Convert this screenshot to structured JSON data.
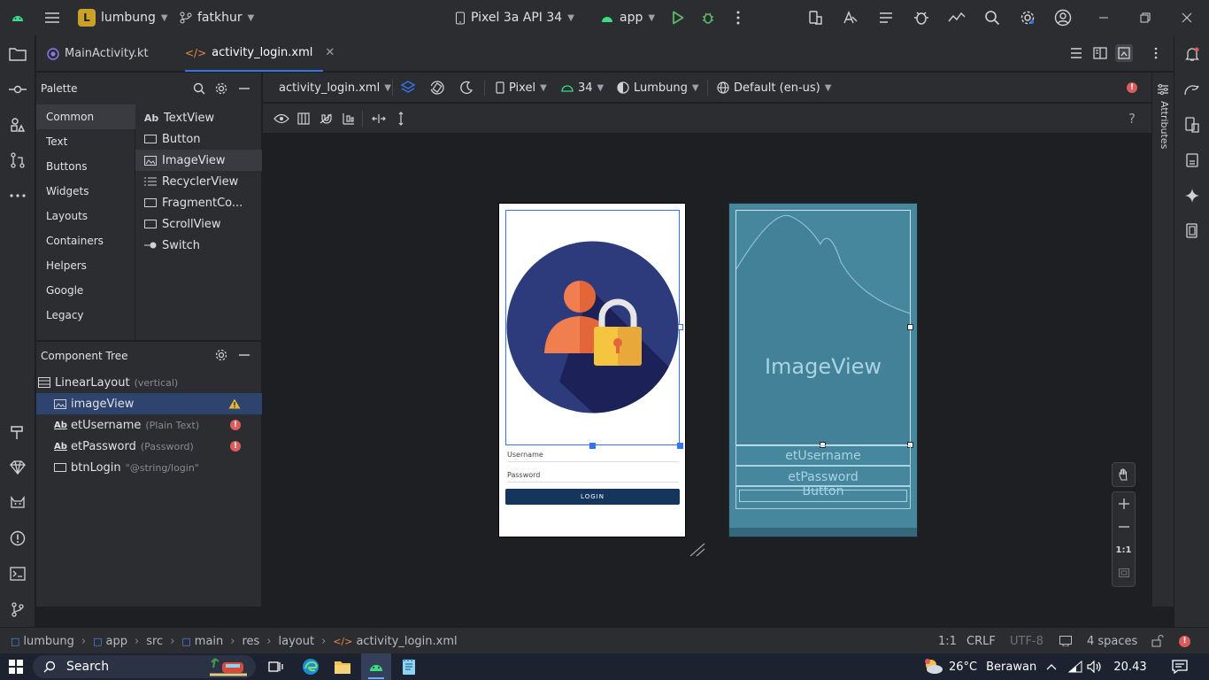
{
  "titlebar": {
    "project_badge": "L",
    "project_name": "lumbung",
    "branch": "fatkhur",
    "device": "Pixel 3a API 34",
    "run_config": "app"
  },
  "tabs": [
    {
      "label": "MainActivity.kt",
      "active": false
    },
    {
      "label": "activity_login.xml",
      "active": true
    }
  ],
  "palette": {
    "title": "Palette",
    "categories": [
      "Common",
      "Text",
      "Buttons",
      "Widgets",
      "Layouts",
      "Containers",
      "Helpers",
      "Google",
      "Legacy"
    ],
    "selected_category": "Common",
    "items": [
      {
        "icon": "Ab",
        "label": "TextView"
      },
      {
        "icon": "button-widget-icon",
        "label": "Button"
      },
      {
        "icon": "image-widget-icon",
        "label": "ImageView"
      },
      {
        "icon": "list-widget-icon",
        "label": "RecyclerView"
      },
      {
        "icon": "fragment-widget-icon",
        "label": "FragmentCo..."
      },
      {
        "icon": "scroll-widget-icon",
        "label": "ScrollView"
      },
      {
        "icon": "switch-widget-icon",
        "label": "Switch"
      }
    ],
    "selected_item": "ImageView"
  },
  "component_tree": {
    "title": "Component Tree",
    "root": {
      "label": "LinearLayout",
      "hint": "(vertical)"
    },
    "children": [
      {
        "icon": "image-widget-icon",
        "label": "imageView",
        "hint": "",
        "status": "warning"
      },
      {
        "icon": "Ab",
        "label": "etUsername",
        "hint": "(Plain Text)",
        "status": "error"
      },
      {
        "icon": "Ab",
        "label": "etPassword",
        "hint": "(Password)",
        "status": "error"
      },
      {
        "icon": "button-widget-icon",
        "label": "btnLogin",
        "hint": "\"@string/login\"",
        "status": ""
      }
    ]
  },
  "design_toolbar": {
    "file": "activity_login.xml",
    "device": "Pixel",
    "api": "34",
    "theme": "Lumbung",
    "locale": "Default (en-us)"
  },
  "preview": {
    "username_hint": "Username",
    "password_hint": "Password",
    "login_label": "LOGIN",
    "login_color": "#14365c"
  },
  "blueprint": {
    "image_label": "ImageView",
    "username_label": "etUsername",
    "password_label": "etPassword",
    "button_label": "Button"
  },
  "attributes_label": "Attributes",
  "zoom": {
    "fit_label": "1:1"
  },
  "breadcrumb": [
    "lumbung",
    "app",
    "src",
    "main",
    "res",
    "layout",
    "activity_login.xml"
  ],
  "status": {
    "position": "1:1",
    "line_sep": "CRLF",
    "encoding": "UTF-8",
    "indent": "4 spaces"
  },
  "taskbar": {
    "search_label": "Search",
    "weather_temp": "26°C",
    "weather_text": "Berawan",
    "time": "20.43"
  },
  "colors": {
    "accent": "#3574f0",
    "error": "#db5c5c",
    "warning": "#e5b73b",
    "blueprint_bg": "#47879e"
  }
}
